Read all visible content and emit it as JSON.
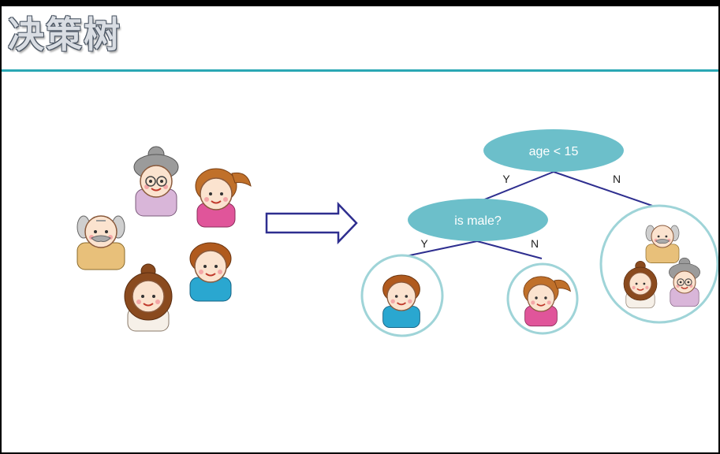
{
  "title": "决策树",
  "tree": {
    "root": {
      "label": "age < 15",
      "yes": "Y",
      "no": "N"
    },
    "child": {
      "label": "is male?",
      "yes": "Y",
      "no": "N"
    }
  },
  "colors": {
    "accent": "#2aa7b4",
    "node_fill": "#6cbfca",
    "edge": "#2e2e8f",
    "arrow_fill": "#ffffff",
    "arrow_stroke": "#2e2e8f",
    "leaf_ring": "#9fd4d8"
  },
  "people": [
    "grandmother",
    "girl",
    "grandfather",
    "boy",
    "woman"
  ]
}
